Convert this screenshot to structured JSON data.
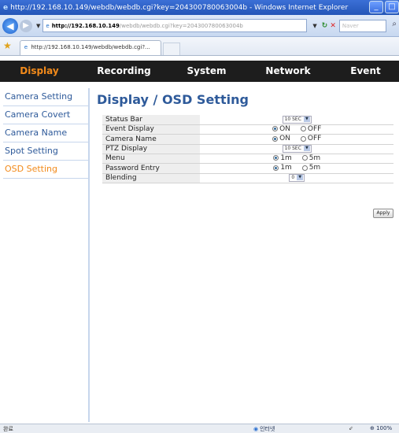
{
  "window": {
    "title": "http://192.168.10.149/webdb/webdb.cgi?key=204300780063004b - Windows Internet Explorer",
    "minimize": "_",
    "restore": "□"
  },
  "address_bar": {
    "url_host": "http://192.168.10.149",
    "url_rest": "/webdb/webdb.cgi?key=204300780063004b",
    "search_placeholder": "Naver"
  },
  "tab": {
    "label": "http://192.168.10.149/webdb/webdb.cgi?..."
  },
  "main_nav": {
    "items": [
      "Display",
      "Recording",
      "System",
      "Network",
      "Event"
    ],
    "active_index": 0,
    "active_color": "#f28a1a"
  },
  "sidebar": {
    "items": [
      "Camera Setting",
      "Camera Covert",
      "Camera Name",
      "Spot Setting",
      "OSD Setting"
    ],
    "active_index": 4
  },
  "page": {
    "title": "Display / OSD Setting"
  },
  "settings": {
    "status_bar": {
      "label": "Status Bar",
      "value": "10 SEC"
    },
    "event_display": {
      "label": "Event Display",
      "opt1": "ON",
      "opt2": "OFF",
      "selected": "ON"
    },
    "camera_name": {
      "label": "Camera Name",
      "opt1": "ON",
      "opt2": "OFF",
      "selected": "ON"
    },
    "ptz_display": {
      "label": "PTZ Display",
      "value": "10 SEC"
    },
    "menu": {
      "label": "Menu",
      "opt1": "1m",
      "opt2": "5m",
      "selected": "1m"
    },
    "password_entry": {
      "label": "Password Entry",
      "opt1": "1m",
      "opt2": "5m",
      "selected": "1m"
    },
    "blending": {
      "label": "Blending",
      "value": "0"
    }
  },
  "apply_label": "Apply",
  "status_bar": {
    "left_text": "완료",
    "zone_text": "인터넷",
    "zoom_text": "100%"
  },
  "colors": {
    "nav_bg": "#1d1d1d",
    "link_blue": "#2e5a9a",
    "label_bg": "#eeeeee"
  }
}
